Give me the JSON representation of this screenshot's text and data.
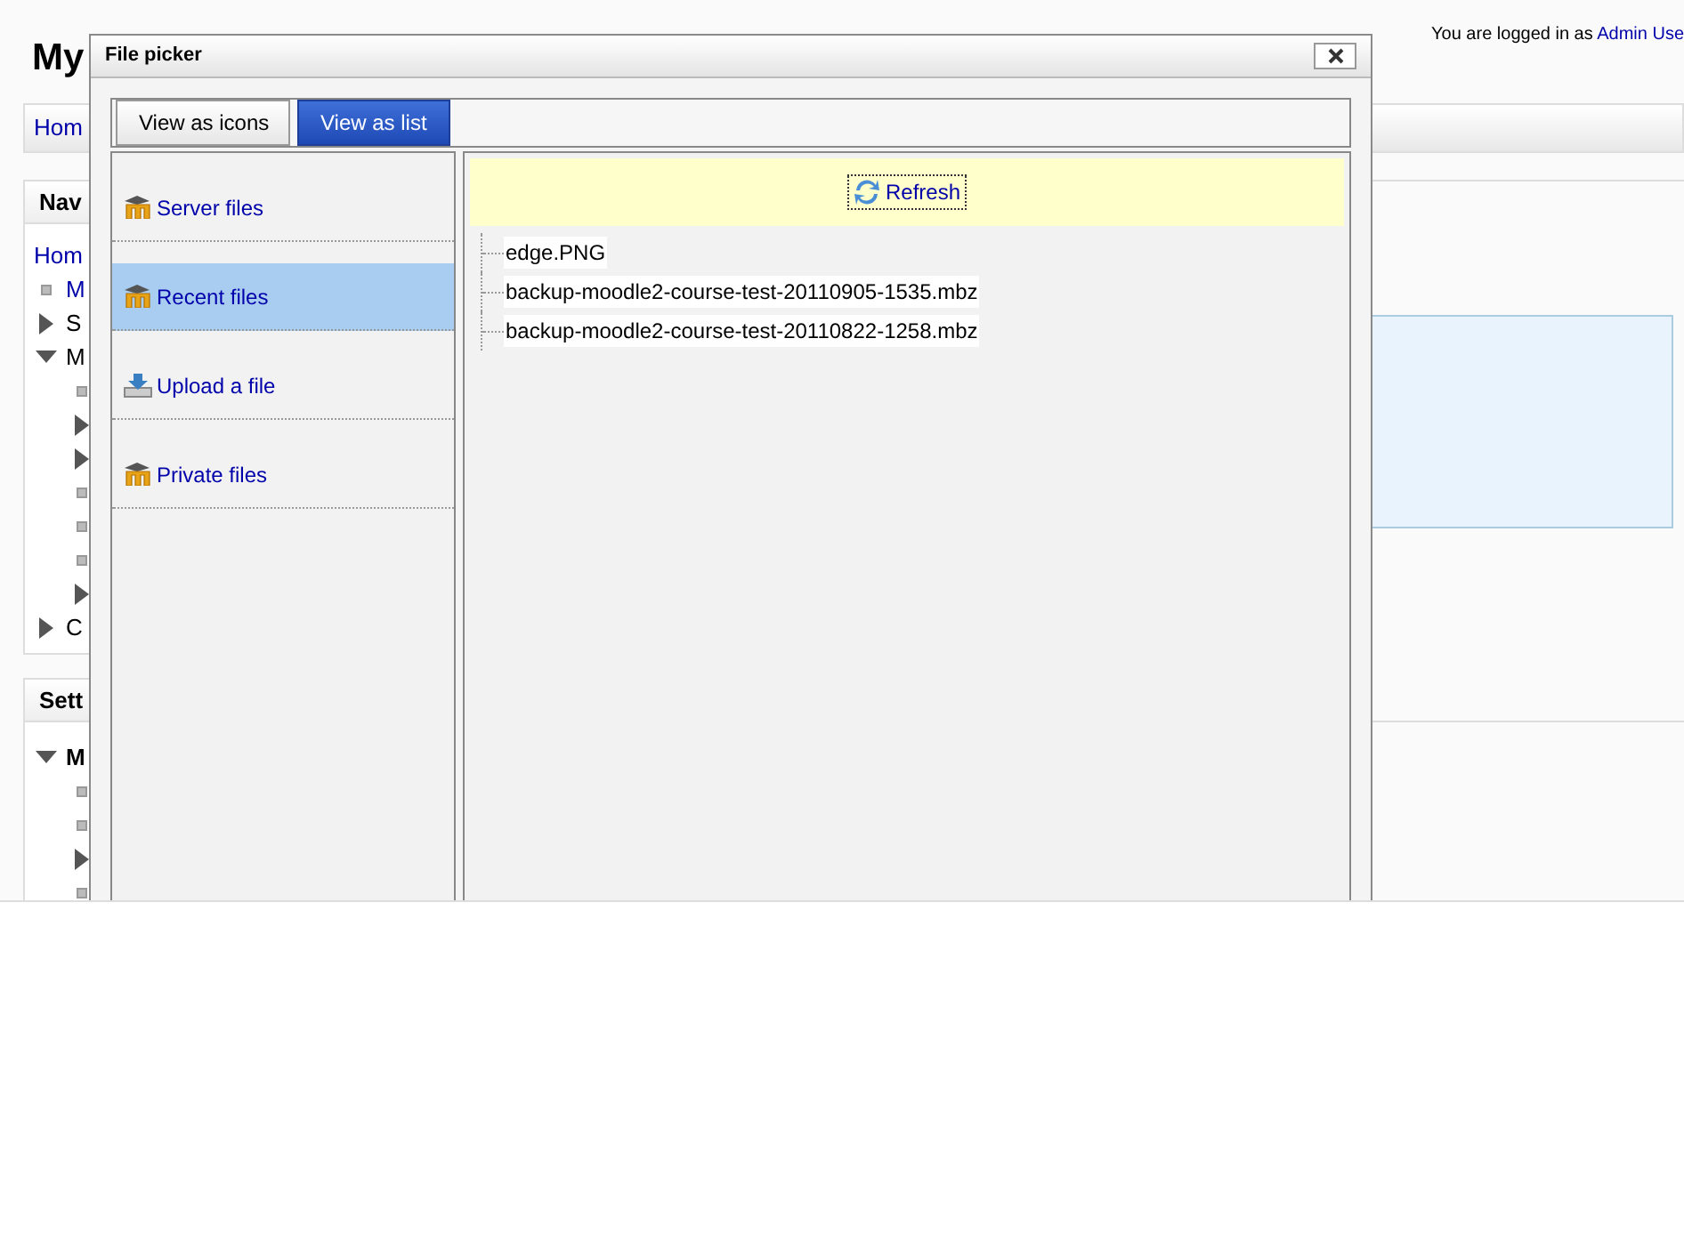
{
  "header": {
    "login_text": "You are logged in as",
    "user_link": "Admin Use"
  },
  "page_title": "My",
  "breadcrumb": {
    "link": "Hom"
  },
  "navigation": {
    "title": "Nav",
    "home": "Hom",
    "items": [
      {
        "kind": "leaf",
        "label": "M",
        "link": true
      },
      {
        "kind": "branch",
        "label": "S",
        "expanded": false
      },
      {
        "kind": "branch",
        "label": "M",
        "expanded": true,
        "children": [
          {
            "kind": "leaf"
          },
          {
            "kind": "branch",
            "expanded": false
          },
          {
            "kind": "branch",
            "expanded": false
          },
          {
            "kind": "leaf"
          },
          {
            "kind": "leaf"
          },
          {
            "kind": "leaf"
          },
          {
            "kind": "branch",
            "expanded": false
          }
        ]
      },
      {
        "kind": "branch",
        "label": "C",
        "expanded": false
      }
    ]
  },
  "settings": {
    "title": "Sett",
    "items": [
      {
        "kind": "branch",
        "label": "M",
        "expanded": true,
        "children": [
          {
            "kind": "leaf"
          },
          {
            "kind": "leaf"
          },
          {
            "kind": "branch",
            "expanded": false
          },
          {
            "kind": "leaf"
          }
        ]
      }
    ]
  },
  "dialog": {
    "title": "File picker",
    "tabs": [
      {
        "label": "View as icons",
        "selected": false
      },
      {
        "label": "View as list",
        "selected": true
      }
    ],
    "repositories": [
      {
        "label": "Server files",
        "kind": "moodle",
        "selected": false
      },
      {
        "label": "Recent files",
        "kind": "moodle",
        "selected": true
      },
      {
        "label": "Upload a file",
        "kind": "upload",
        "selected": false
      },
      {
        "label": "Private files",
        "kind": "moodle",
        "selected": false
      }
    ],
    "refresh": "Refresh",
    "files": [
      "edge.PNG",
      "backup-moodle2-course-test-20110905-1535.mbz",
      "backup-moodle2-course-test-20110822-1258.mbz"
    ]
  }
}
